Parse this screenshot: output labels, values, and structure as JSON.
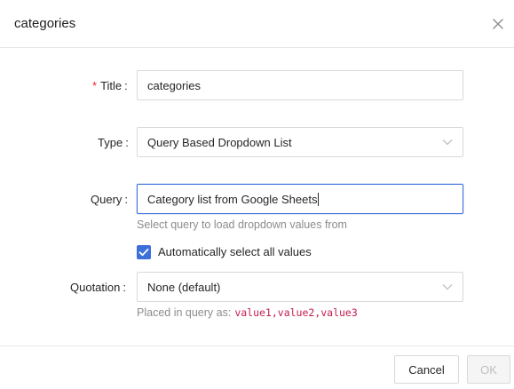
{
  "dialog": {
    "title": "categories"
  },
  "form": {
    "title": {
      "label": "Title",
      "separator": ":",
      "required_mark": "*",
      "value": "categories"
    },
    "type": {
      "label": "Type",
      "separator": ":",
      "value": "Query Based Dropdown List"
    },
    "query": {
      "label": "Query",
      "separator": ":",
      "value": "Category list from Google Sheets",
      "hint": "Select query to load dropdown values from"
    },
    "auto_select": {
      "label": "Automatically select all values",
      "checked": true
    },
    "quotation": {
      "label": "Quotation",
      "separator": ":",
      "value": "None (default)",
      "hint_prefix": "Placed in query as:",
      "hint_code": "value1,value2,value3"
    }
  },
  "footer": {
    "cancel_label": "Cancel",
    "ok_label": "OK"
  },
  "colors": {
    "accent": "#3c6fdc",
    "required": "#f5222d",
    "code": "#c41d4f"
  },
  "icons": {
    "close": "close-icon",
    "dropdown": "chevron-down-icon",
    "checkbox": "checkmark-icon"
  }
}
